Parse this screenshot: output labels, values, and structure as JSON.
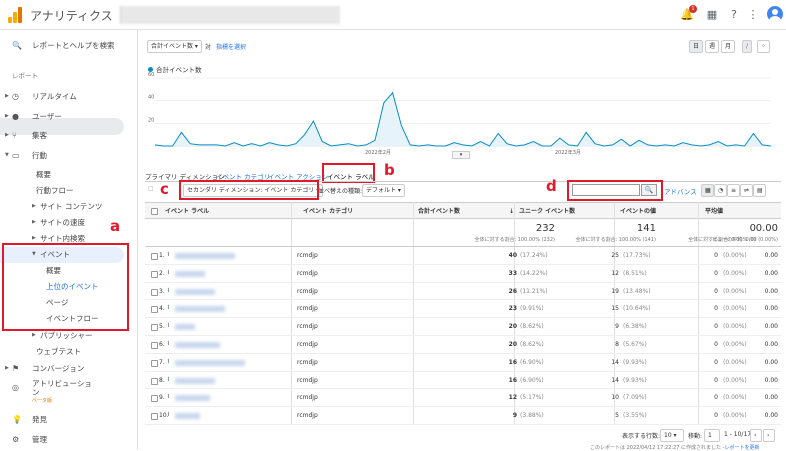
{
  "app": {
    "title": "アナリティクス",
    "notif_count": "1"
  },
  "sidebar": {
    "search": "レポートとヘルプを検索",
    "section": "レポート",
    "items": [
      {
        "label": "リアルタイム"
      },
      {
        "label": "ユーザー"
      },
      {
        "label": "集客"
      },
      {
        "label": "行動"
      },
      {
        "label": "概要"
      },
      {
        "label": "行動フロー"
      },
      {
        "label": "サイト コンテンツ"
      },
      {
        "label": "サイトの速度"
      },
      {
        "label": "サイト内検索"
      },
      {
        "label": "イベント"
      },
      {
        "label": "概要"
      },
      {
        "label": "上位のイベント"
      },
      {
        "label": "ページ"
      },
      {
        "label": "イベントフロー"
      },
      {
        "label": "パブリッシャー"
      },
      {
        "label": "ウェブテスト"
      },
      {
        "label": "コンバージョン"
      },
      {
        "label": "アトリビューション"
      },
      {
        "label": "ベータ版"
      },
      {
        "label": "発見"
      },
      {
        "label": "管理"
      }
    ]
  },
  "toolbar": {
    "metric_select": "合計イベント数",
    "vs": "対",
    "pick_metric": "指標を選択",
    "periods": [
      "日",
      "週",
      "月"
    ]
  },
  "chart_data": {
    "type": "line",
    "legend": "合計イベント数",
    "yticks": [
      "60",
      "40",
      "20"
    ],
    "xticks": [
      "2022年2月",
      "2022年3月"
    ],
    "ylim": [
      0,
      60
    ],
    "values": [
      1,
      0,
      0,
      12,
      2,
      1,
      1,
      1,
      0,
      3,
      0,
      2,
      0,
      3,
      1,
      0,
      2,
      10,
      22,
      4,
      0,
      1,
      2,
      0,
      1,
      5,
      38,
      47,
      18,
      1,
      0,
      1,
      0,
      0,
      3,
      1,
      0,
      4,
      0,
      11,
      2,
      0,
      1,
      4,
      0,
      0,
      7,
      1,
      0,
      12,
      2,
      0,
      1,
      6,
      0,
      5,
      1,
      0,
      1,
      0,
      3,
      1,
      0,
      1,
      4,
      0,
      1,
      0,
      11,
      1,
      0
    ]
  },
  "dimension_bar": {
    "primary_label": "プライマリ ディメンション:",
    "dims": [
      "イベント カテゴリ",
      "イベント アクション",
      "イベント ラベル"
    ]
  },
  "filters": {
    "secondary": "セカンダリ ディメンション: イベント カテゴリ",
    "sort": "並べ替えの種類:",
    "default": "デフォルト",
    "advanced": "アドバンス"
  },
  "annotations": {
    "a": "a",
    "b": "b",
    "c": "c",
    "d": "d"
  },
  "table": {
    "headers": [
      "イベント ラベル",
      "イベント カテゴリ",
      "合計イベント数",
      "ユニーク イベント数",
      "イベントの値",
      "平均値"
    ],
    "totals": {
      "total": "232",
      "total_sub": "全体に対する割合: 100.00% (232)",
      "unique": "141",
      "unique_sub": "全体に対する割合: 100.00% (141)",
      "value": "0",
      "value_sub": "全体に対する割合: 0.00% (0)",
      "avg": "0.00",
      "avg_sub": "ビューの平均: 0.00 (0.00%)"
    },
    "rows": [
      {
        "n": "1.",
        "cat": "rcmdjp",
        "total": "40",
        "tpct": "(17.24%)",
        "uniq": "25",
        "upct": "(17.73%)",
        "val": "0",
        "vpct": "(0.00%)",
        "avg": "0.00"
      },
      {
        "n": "2.",
        "cat": "rcmdjp",
        "total": "33",
        "tpct": "(14.22%)",
        "uniq": "12",
        "upct": "(8.51%)",
        "val": "0",
        "vpct": "(0.00%)",
        "avg": "0.00"
      },
      {
        "n": "3.",
        "cat": "rcmdjp",
        "total": "26",
        "tpct": "(11.21%)",
        "uniq": "19",
        "upct": "(13.48%)",
        "val": "0",
        "vpct": "(0.00%)",
        "avg": "0.00"
      },
      {
        "n": "4.",
        "cat": "rcmdjp",
        "total": "23",
        "tpct": "(9.91%)",
        "uniq": "15",
        "upct": "(10.64%)",
        "val": "0",
        "vpct": "(0.00%)",
        "avg": "0.00"
      },
      {
        "n": "5.",
        "cat": "rcmdjp",
        "total": "20",
        "tpct": "(8.62%)",
        "uniq": "9",
        "upct": "(6.38%)",
        "val": "0",
        "vpct": "(0.00%)",
        "avg": "0.00"
      },
      {
        "n": "6.",
        "cat": "rcmdjp",
        "total": "20",
        "tpct": "(8.62%)",
        "uniq": "8",
        "upct": "(5.67%)",
        "val": "0",
        "vpct": "(0.00%)",
        "avg": "0.00"
      },
      {
        "n": "7.",
        "cat": "rcmdjp",
        "total": "16",
        "tpct": "(6.90%)",
        "uniq": "14",
        "upct": "(9.93%)",
        "val": "0",
        "vpct": "(0.00%)",
        "avg": "0.00"
      },
      {
        "n": "8.",
        "cat": "rcmdjp",
        "total": "16",
        "tpct": "(6.90%)",
        "uniq": "14",
        "upct": "(9.93%)",
        "val": "0",
        "vpct": "(0.00%)",
        "avg": "0.00"
      },
      {
        "n": "9.",
        "cat": "rcmdjp",
        "total": "12",
        "tpct": "(5.17%)",
        "uniq": "10",
        "upct": "(7.09%)",
        "val": "0",
        "vpct": "(0.00%)",
        "avg": "0.00"
      },
      {
        "n": "10.",
        "cat": "rcmdjp",
        "total": "9",
        "tpct": "(3.88%)",
        "uniq": "5",
        "upct": "(3.55%)",
        "val": "0",
        "vpct": "(0.00%)",
        "avg": "0.00"
      }
    ]
  },
  "pagination": {
    "rows_label": "表示する行数:",
    "rows_value": "10",
    "goto": "移動:",
    "goto_value": "1",
    "range": "1 - 10/17"
  },
  "footer": {
    "text": "このレポートは 2022/04/12 17:22:27 に作成されました -",
    "link": "レポートを更新"
  }
}
